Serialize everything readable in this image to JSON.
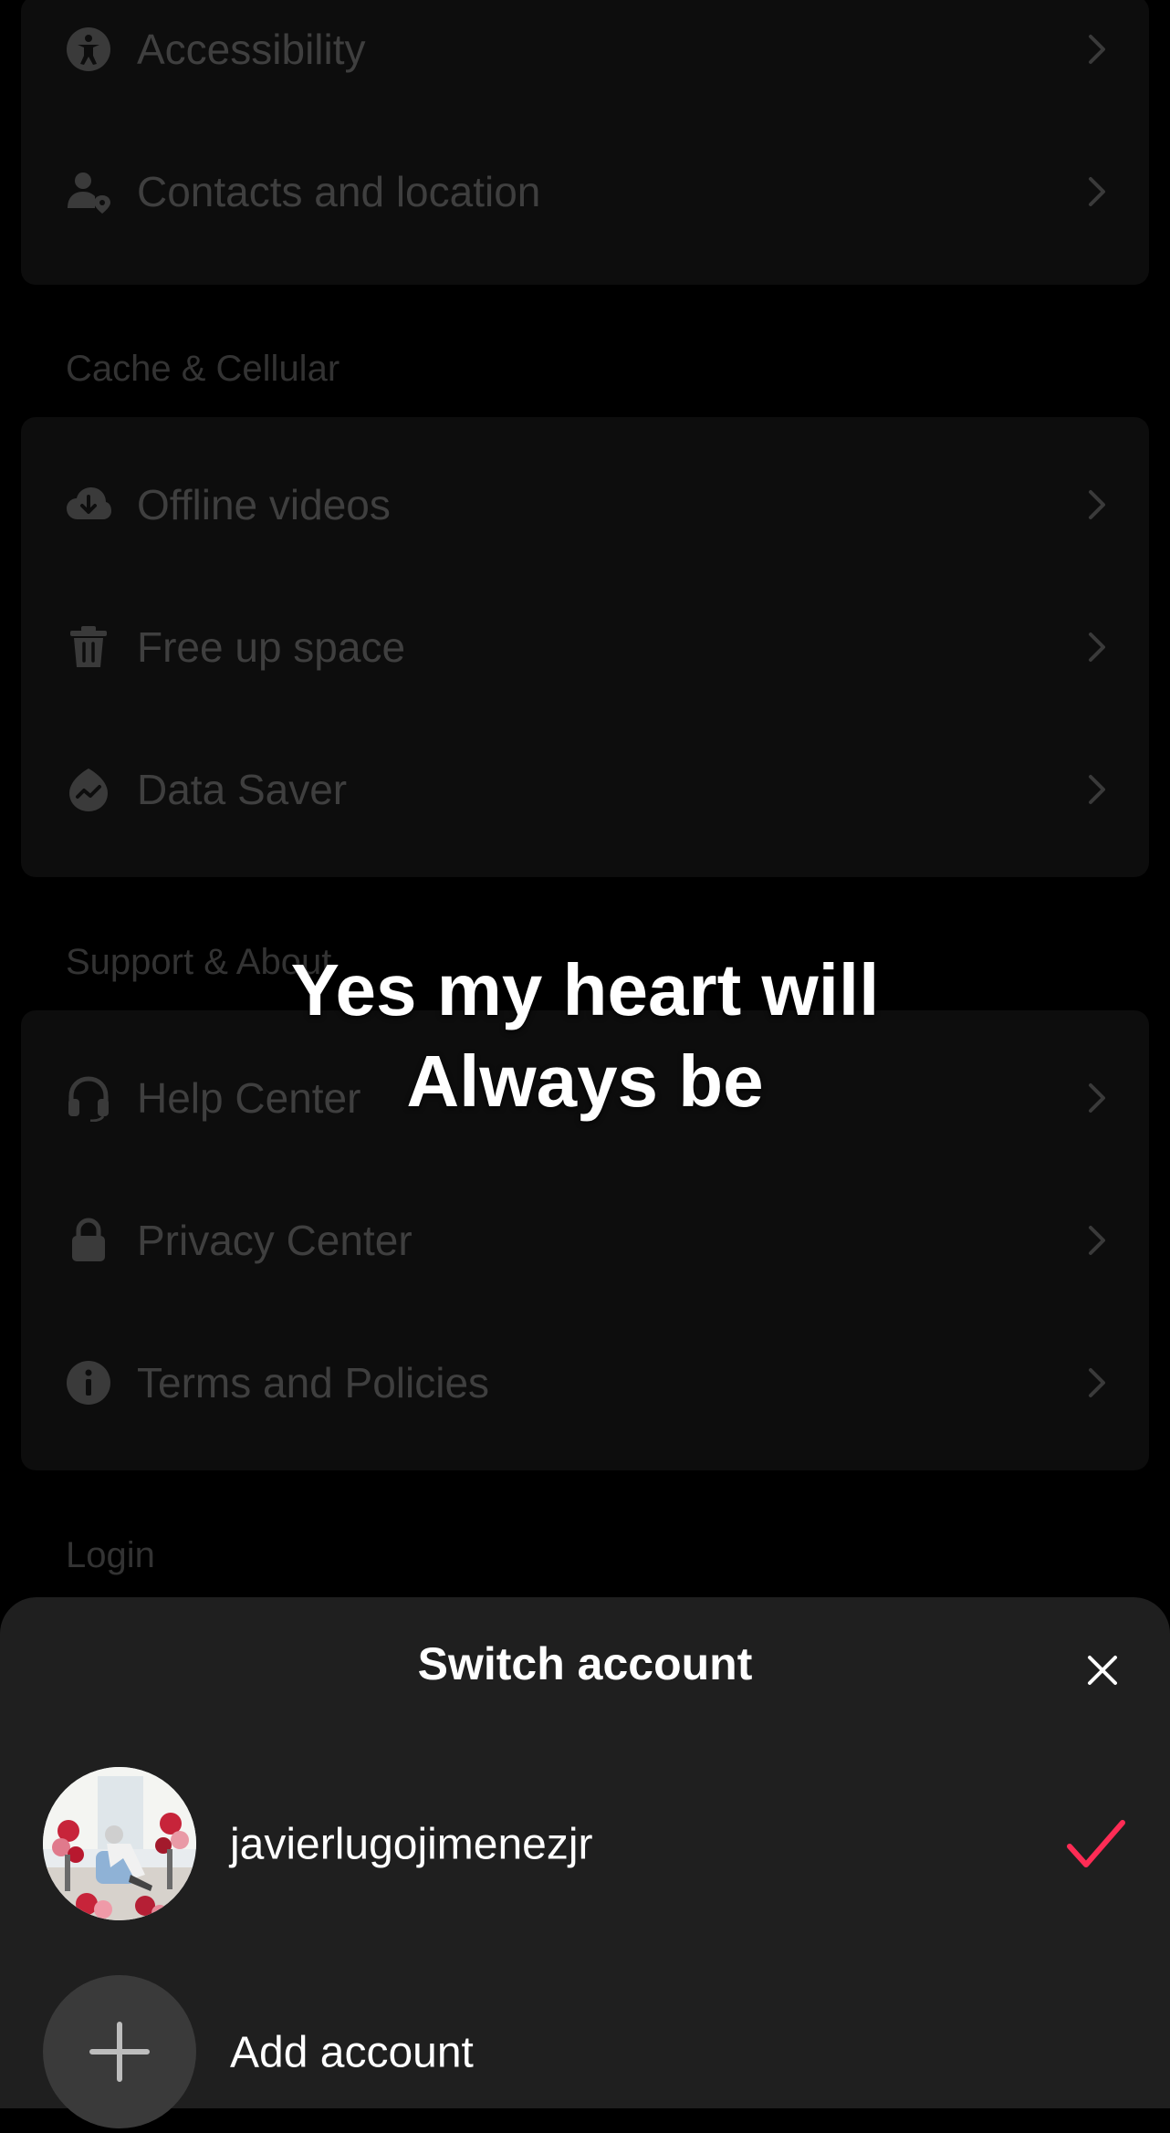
{
  "settings": {
    "group1": [
      {
        "label": "Accessibility",
        "icon": "accessibility-icon"
      },
      {
        "label": "Contacts and location",
        "icon": "contacts-location-icon"
      }
    ],
    "cache_section_title": "Cache & Cellular",
    "group2": [
      {
        "label": "Offline videos",
        "icon": "cloud-download-icon"
      },
      {
        "label": "Free up space",
        "icon": "trash-icon"
      },
      {
        "label": "Data Saver",
        "icon": "data-saver-icon"
      }
    ],
    "support_section_title": "Support & About",
    "group3": [
      {
        "label": "Help Center",
        "icon": "headphones-icon"
      },
      {
        "label": "Privacy Center",
        "icon": "lock-icon"
      },
      {
        "label": "Terms and Policies",
        "icon": "info-icon"
      }
    ],
    "login_section_title": "Login"
  },
  "caption": {
    "line1": "Yes my heart will",
    "line2": "Always be"
  },
  "sheet": {
    "title": "Switch account",
    "account": {
      "username": "javierlugojimenezjr",
      "selected": true
    },
    "add_account_label": "Add account"
  },
  "colors": {
    "accent_check": "#fe2c55",
    "sheet_bg": "#1f1f1f",
    "card_bg": "#0d0d0d"
  }
}
